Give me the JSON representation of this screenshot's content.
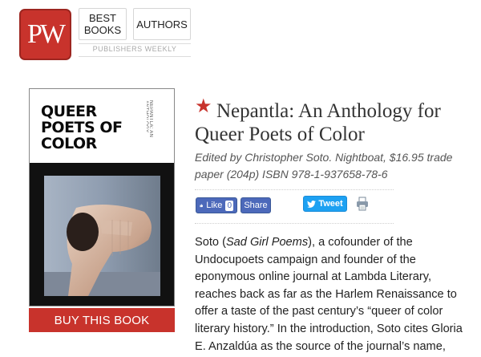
{
  "header": {
    "logo_text": "PW",
    "nav": {
      "best_books_line1": "BEST",
      "best_books_line2": "BOOKS",
      "authors": "AUTHORS"
    },
    "brand_label": "PUBLISHERS WEEKLY"
  },
  "book": {
    "cover_title_lines": [
      "QUEER",
      "POETS OF",
      "COLOR"
    ],
    "cover_spine_text": "NEPANTLA: AN ANTHOLOGY",
    "buy_label": "BUY THIS BOOK",
    "title": "Nepantla: An Anthology for Queer Poets of Color",
    "edited_line": "Edited by Christopher Soto. Nightboat, $16.95 trade paper (204p) ISBN 978-1-937658-78-6"
  },
  "social": {
    "like_label": "Like",
    "like_count": "0",
    "share_label": "Share",
    "tweet_label": "Tweet"
  },
  "review": {
    "p1_a": "Soto (",
    "p1_title": "Sad Girl Poems",
    "p1_b": "), a cofounder of the Undocupoets campaign and founder of the eponymous online journal at Lambda Literary, reaches back as far as the Harlem Renaissance to offer a taste of the past century’s “queer of color literary history.” In the introduction, Soto cites Gloria E. Anzaldúa as the source of the journal’s name,"
  },
  "colors": {
    "brand_red": "#c8332c",
    "facebook_blue": "#4c69ba",
    "twitter_blue": "#1da1f2"
  },
  "icons": [
    "star-icon",
    "facebook-icon",
    "twitter-icon",
    "print-icon"
  ]
}
